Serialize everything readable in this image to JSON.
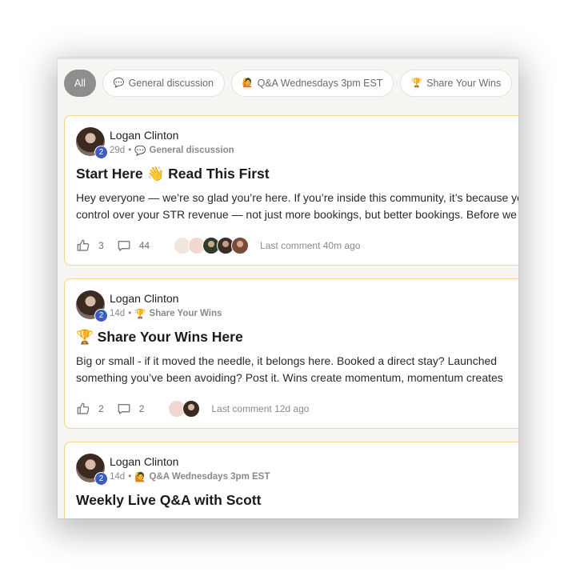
{
  "filters": [
    {
      "label": "All",
      "icon": "",
      "active": true
    },
    {
      "label": "General discussion",
      "icon": "💬",
      "active": false
    },
    {
      "label": "Q&A Wednesdays 3pm EST",
      "icon": "🙋",
      "active": false
    },
    {
      "label": "Share Your Wins",
      "icon": "🏆",
      "active": false
    }
  ],
  "posts": [
    {
      "author": "Logan Clinton",
      "level": "2",
      "age": "29d",
      "category_icon": "💬",
      "category": "General discussion",
      "title": "Start Here 👋 Read This First",
      "body_line1": "Hey everyone — we’re so glad you’re here. If you’re inside this community, it’s because you",
      "body_line2": "control over your STR revenue — not just more bookings, but better bookings. Before we di",
      "likes": "3",
      "comments": "44",
      "last_comment": "Last comment 40m ago"
    },
    {
      "author": "Logan Clinton",
      "level": "2",
      "age": "14d",
      "category_icon": "🏆",
      "category": "Share Your Wins",
      "title": "🏆 Share Your Wins Here",
      "body_line1": "Big or small - if it moved the needle, it belongs here. Booked a direct stay? Launched",
      "body_line2": "something you’ve been avoiding? Post it. Wins create momentum, momentum creates",
      "likes": "2",
      "comments": "2",
      "last_comment": "Last comment 12d ago"
    },
    {
      "author": "Logan Clinton",
      "level": "2",
      "age": "14d",
      "category_icon": "🙋",
      "category": "Q&A Wednesdays 3pm EST",
      "title": "Weekly Live Q&A with Scott"
    }
  ],
  "colors": {
    "card_border": "#f2d489",
    "badge": "#3b5cc4",
    "chip_active": "#8e8e8e"
  }
}
